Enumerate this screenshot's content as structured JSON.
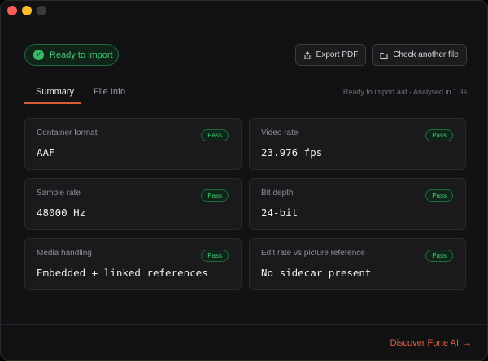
{
  "window": {
    "controls": [
      "close-button",
      "minimize-button",
      "maximize-button"
    ]
  },
  "status": {
    "label": "Ready to import",
    "icon": "check-circle-icon",
    "color": "#43c874"
  },
  "toolbar": {
    "export_label": "Export PDF",
    "export_icon": "share-icon",
    "check_label": "Check another file",
    "check_icon": "folder-icon"
  },
  "tabs": {
    "items": [
      {
        "label": "Summary",
        "active": true
      },
      {
        "label": "File Info",
        "active": false
      }
    ],
    "meta": "Ready to import.aaf · Analysed in 1.3s"
  },
  "cards": [
    {
      "label": "Container format",
      "value": "AAF",
      "badge": "Pass"
    },
    {
      "label": "Video rate",
      "value": "23.976 fps",
      "badge": "Pass"
    },
    {
      "label": "Sample rate",
      "value": "48000 Hz",
      "badge": "Pass"
    },
    {
      "label": "Bit depth",
      "value": "24-bit",
      "badge": "Pass"
    },
    {
      "label": "Media handling",
      "value": "Embedded + linked references",
      "badge": "Pass"
    },
    {
      "label": "Edit rate vs picture reference",
      "value": "No sidecar present",
      "badge": "Pass"
    }
  ],
  "footer": {
    "link_label": "Discover Forte AI",
    "link_icon": "arrow-right-icon",
    "accent": "#e0603f"
  }
}
